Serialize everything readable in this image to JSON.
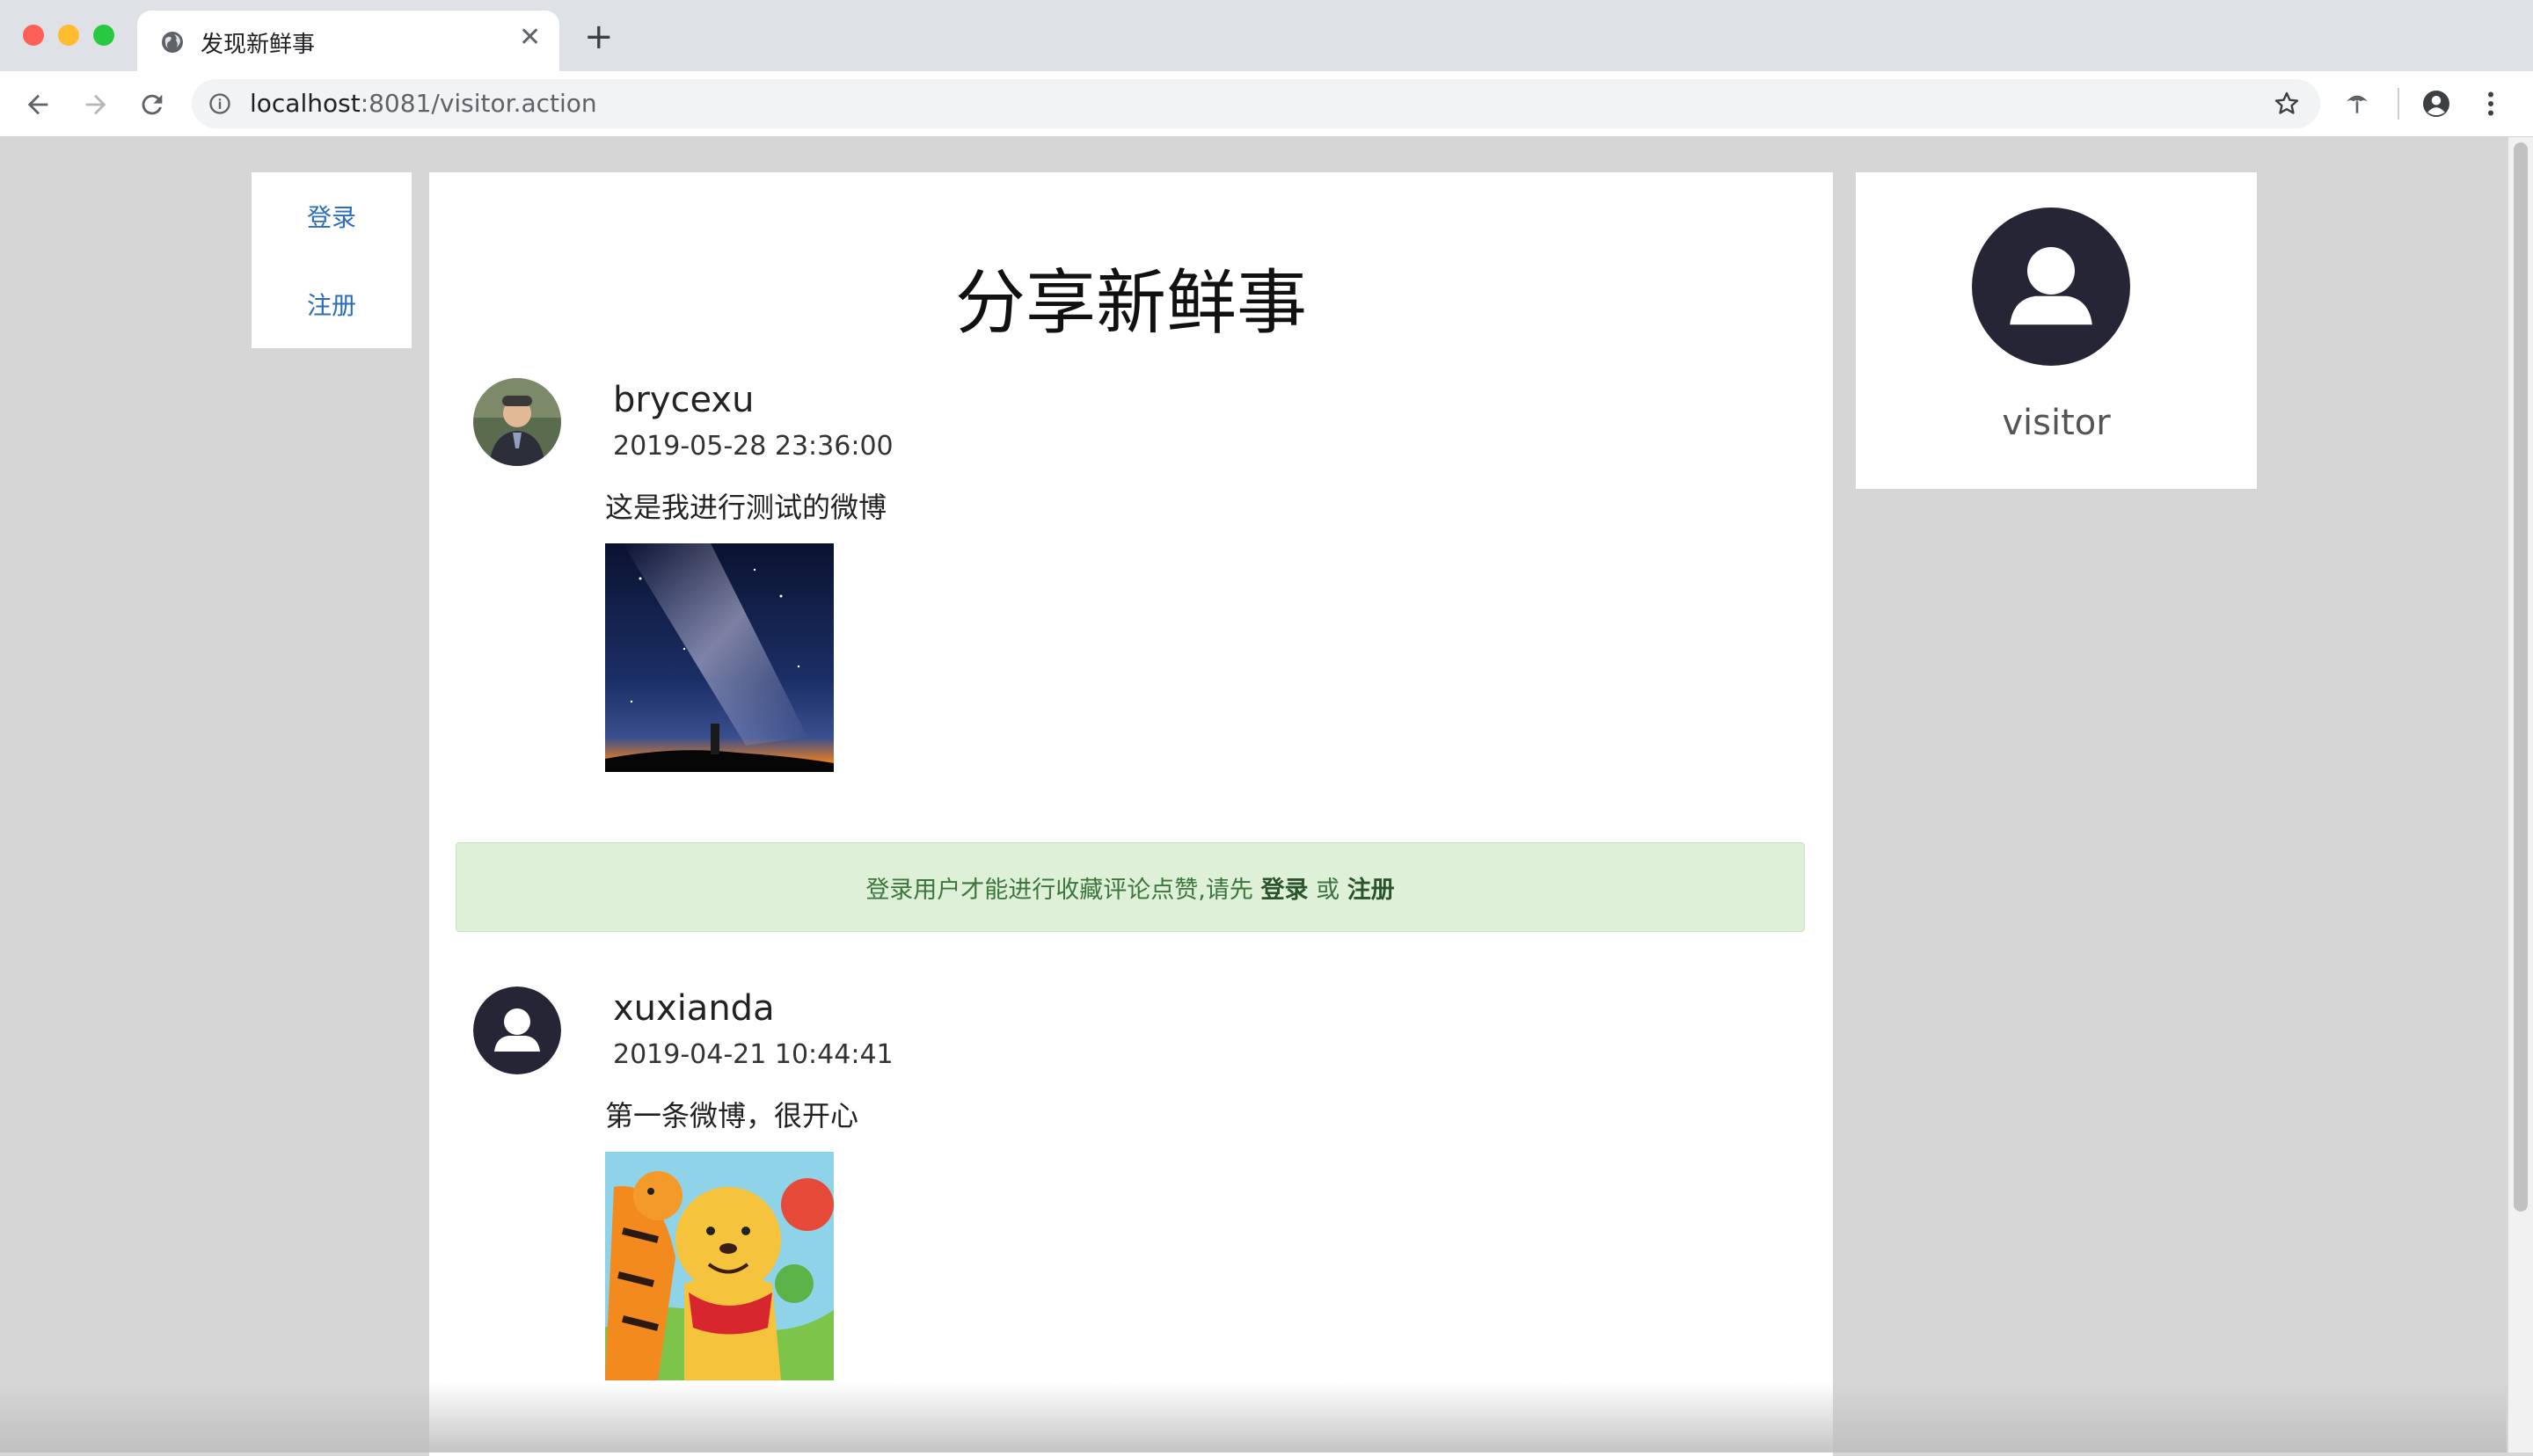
{
  "browser": {
    "tab_title": "发现新鲜事",
    "url_host": "localhost",
    "url_rest": ":8081/visitor.action",
    "close_symbol": "✕",
    "new_tab_symbol": "+",
    "icons": [
      "globe-icon",
      "back-icon",
      "forward-icon",
      "reload-icon",
      "info-icon",
      "star-icon",
      "extension-icon",
      "account-icon",
      "menu-icon"
    ]
  },
  "sidebar": {
    "login": "登录",
    "register": "注册"
  },
  "feed": {
    "title": "分享新鲜事",
    "posts": [
      {
        "user": "brycexu",
        "time": "2019-05-28 23:36:00",
        "text": "这是我进行测试的微博",
        "image": "milky-way-photo"
      },
      {
        "user": "xuxianda",
        "time": "2019-04-21 10:44:41",
        "text": "第一条微博，很开心",
        "image": "winnie-the-pooh-tigger-cartoon"
      }
    ],
    "notice": {
      "prefix": "登录用户才能进行收藏评论点赞,请先",
      "login": "登录",
      "or": "或",
      "register": "注册"
    }
  },
  "profile": {
    "name": "visitor"
  },
  "colors": {
    "link": "#2a6ebb",
    "alert_bg": "#dff0d8",
    "alert_text": "#3c763d",
    "avatar_dark": "#262535"
  }
}
